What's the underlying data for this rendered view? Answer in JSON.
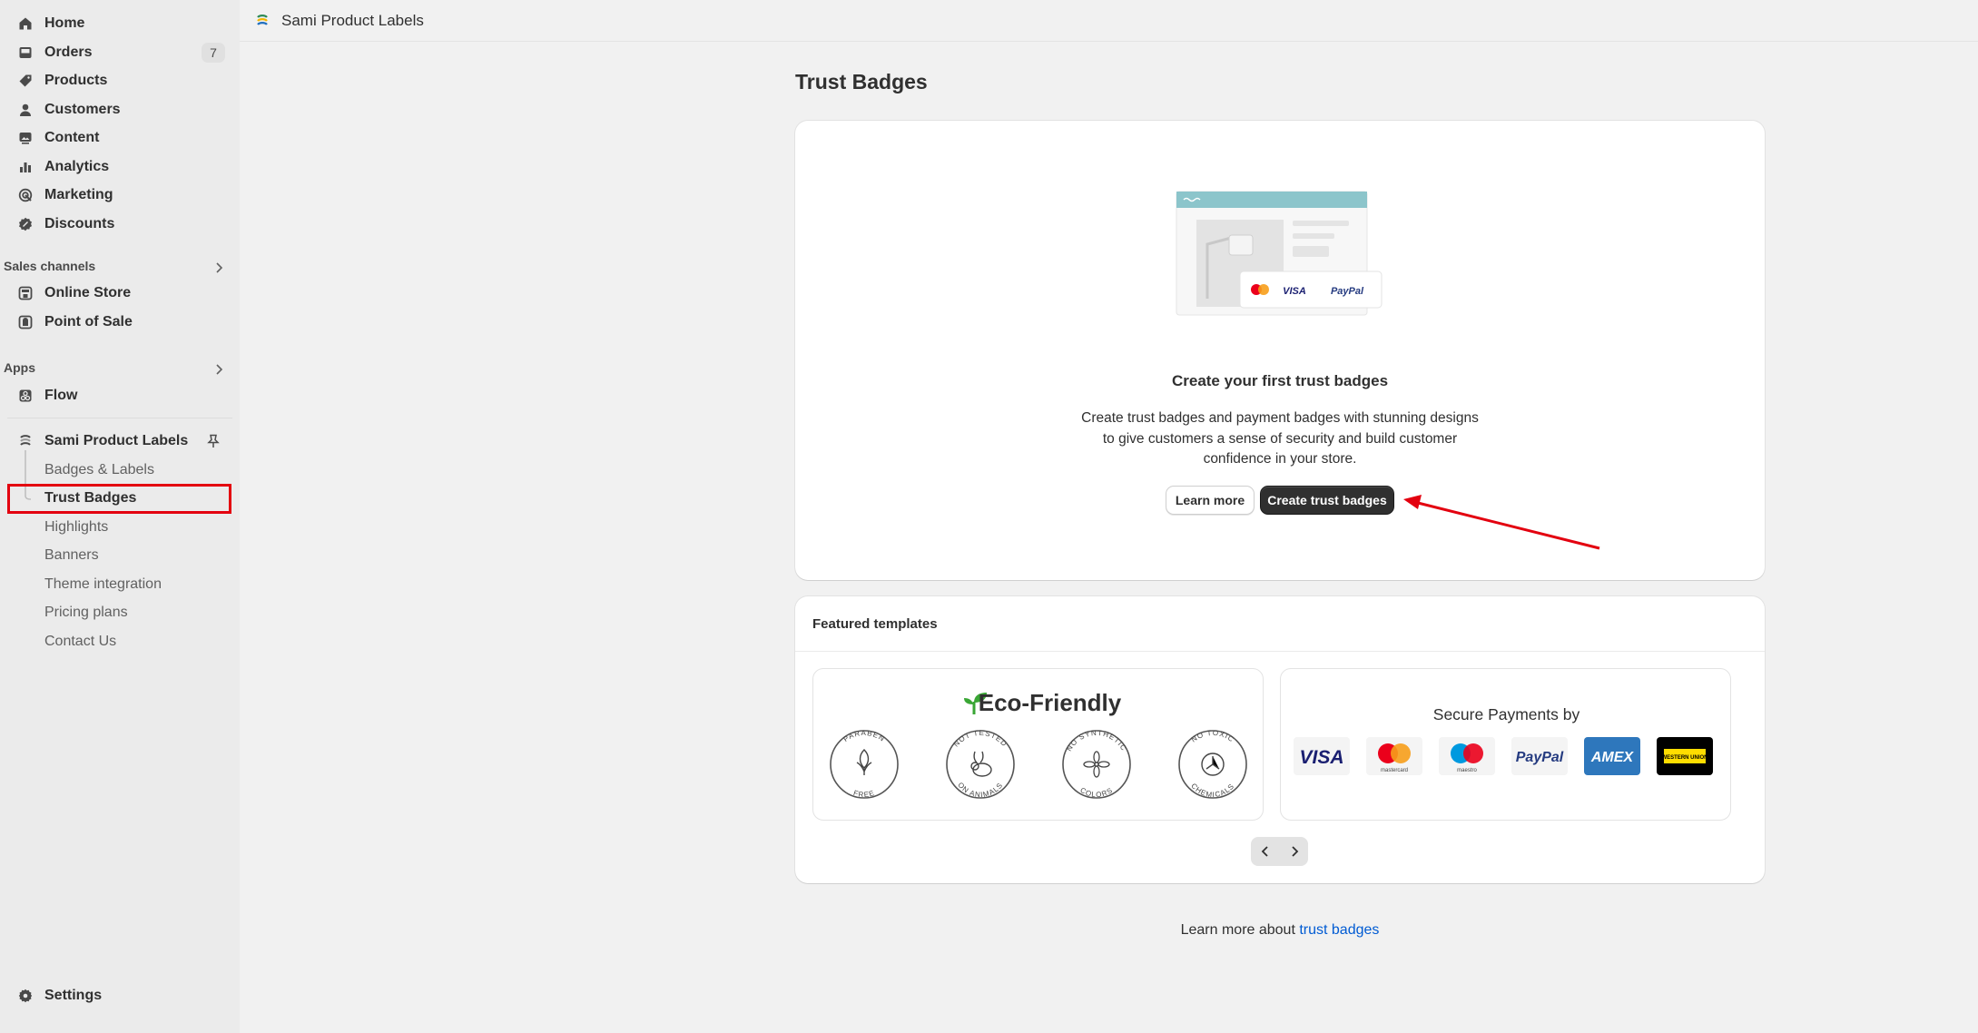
{
  "sidebar": {
    "nav": [
      {
        "label": "Home",
        "icon": "home-icon"
      },
      {
        "label": "Orders",
        "icon": "inbox-icon",
        "count": "7"
      },
      {
        "label": "Products",
        "icon": "tag-icon"
      },
      {
        "label": "Customers",
        "icon": "person-icon"
      },
      {
        "label": "Content",
        "icon": "image-icon"
      },
      {
        "label": "Analytics",
        "icon": "bar-chart-icon"
      },
      {
        "label": "Marketing",
        "icon": "target-icon"
      },
      {
        "label": "Discounts",
        "icon": "discount-icon"
      }
    ],
    "sales_channels_label": "Sales channels",
    "sales_channels": [
      {
        "label": "Online Store",
        "icon": "store-icon"
      },
      {
        "label": "Point of Sale",
        "icon": "pos-icon"
      }
    ],
    "apps_label": "Apps",
    "apps": [
      {
        "label": "Flow",
        "icon": "flow-icon"
      }
    ],
    "pinned_app": {
      "label": "Sami Product Labels",
      "sub_items": [
        "Badges & Labels",
        "Trust Badges",
        "Highlights",
        "Banners",
        "Theme integration",
        "Pricing plans",
        "Contact Us"
      ],
      "active": "Trust Badges"
    },
    "settings_label": "Settings"
  },
  "topbar": {
    "app_name": "Sami Product Labels"
  },
  "page": {
    "title": "Trust Badges",
    "hero": {
      "title": "Create your first trust badges",
      "description": "Create trust badges and payment badges with stunning designs to give customers a sense of security and build customer confidence in your store.",
      "secondary_button": "Learn more",
      "primary_button": "Create trust badges",
      "illustration_payment_labels": [
        "VISA",
        "PayPal"
      ]
    },
    "featured": {
      "title": "Featured templates",
      "templates": [
        {
          "title": "Eco-Friendly",
          "badges": [
            {
              "top": "PARABEN",
              "bottom": "FREE"
            },
            {
              "top": "NOT TESTED",
              "bottom": "ON ANIMALS"
            },
            {
              "top": "NO SYNTHETIC",
              "bottom": "COLORS"
            },
            {
              "top": "NO TOXIC",
              "bottom": "CHEMICALS"
            }
          ]
        },
        {
          "title": "Secure Payments by",
          "payments": [
            {
              "label": "VISA"
            },
            {
              "label": "mastercard"
            },
            {
              "label": "maestro"
            },
            {
              "label": "PayPal"
            },
            {
              "label": "AMEX"
            },
            {
              "label": "WESTERN UNION"
            }
          ]
        }
      ]
    },
    "footer": {
      "text": "Learn more about",
      "link": "trust badges"
    }
  },
  "colors": {
    "sidebar_bg": "#ebebeb",
    "page_bg": "#f1f1f1",
    "primary_button": "#303030",
    "link": "#005bd3",
    "annotation_red": "#e3000f",
    "eco_green": "#3aa635"
  }
}
